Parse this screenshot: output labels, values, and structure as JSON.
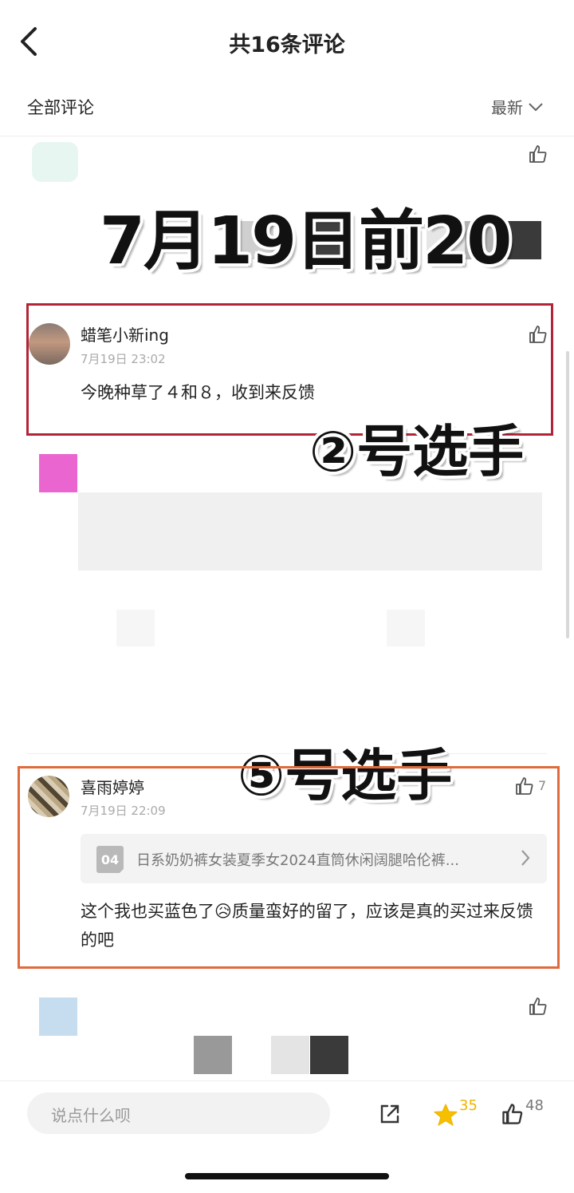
{
  "header": {
    "title": "共16条评论"
  },
  "subbar": {
    "all_label": "全部评论",
    "sort_label": "最新"
  },
  "overlays": {
    "top": "7月19日前20",
    "mid": "②号选手",
    "low": "⑤号选手"
  },
  "comments": [
    {
      "user": "蜡笔小新ing",
      "time": "7月19日 23:02",
      "text": "今晚种草了４和８，收到来反馈"
    },
    {
      "user": "喜雨婷婷",
      "time": "7月19日 22:09",
      "likes": "7",
      "product": {
        "badge": "04",
        "title": "日系奶奶裤女装夏季女2024直筒休闲阔腿哈伦裤..."
      },
      "text": "这个我也买蓝色了😥质量蛮好的留了，应该是真的买过来反馈的吧"
    }
  ],
  "bottom_bar": {
    "placeholder": "说点什么呗",
    "star_count": "35",
    "like_count": "48"
  },
  "colors": {
    "red_box": "#b22437",
    "orange_box": "#e06a3b",
    "star": "#f0b400"
  }
}
